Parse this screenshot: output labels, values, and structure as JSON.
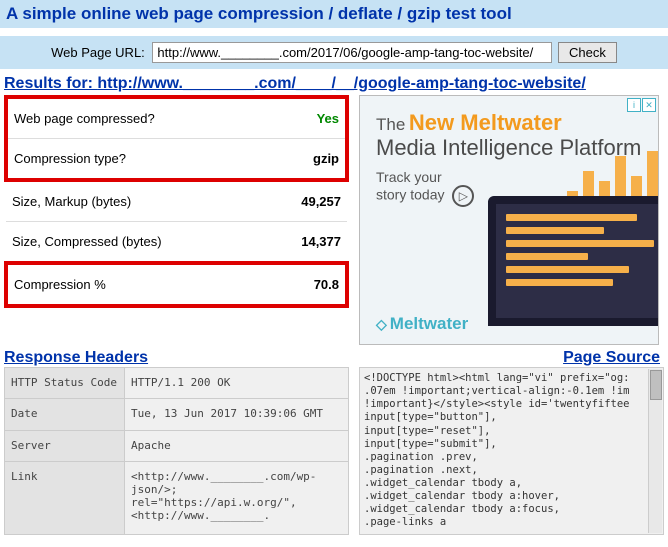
{
  "header": {
    "title": "A simple online web page compression / deflate / gzip test tool"
  },
  "url_form": {
    "label": "Web Page URL:",
    "value": "http://www.________.com/2017/06/google-amp-tang-toc-website/",
    "button": "Check"
  },
  "results": {
    "prefix": "Results for: ",
    "url_display": "http://www.________.com/____/__/google-amp-tang-toc-website/"
  },
  "stats": [
    {
      "label": "Web page compressed?",
      "value": "Yes",
      "highlight": true,
      "greenval": true
    },
    {
      "label": "Compression type?",
      "value": "gzip",
      "highlight": true
    },
    {
      "label": "Size, Markup (bytes)",
      "value": "49,257"
    },
    {
      "label": "Size, Compressed (bytes)",
      "value": "14,377"
    },
    {
      "label": "Compression %",
      "value": "70.8",
      "highlight": true
    }
  ],
  "ad": {
    "the": "The",
    "new_mw": "New Meltwater",
    "mip": "Media Intelligence Platform",
    "cta1": "Track your",
    "cta2": "story today",
    "brand": "Meltwater"
  },
  "sections": {
    "response_headers": "Response Headers",
    "page_source": "Page Source"
  },
  "headers": [
    {
      "key": "HTTP Status Code",
      "val": "HTTP/1.1 200 OK"
    },
    {
      "key": "Date",
      "val": "Tue, 13 Jun 2017 10:39:06 GMT"
    },
    {
      "key": "Server",
      "val": "Apache"
    },
    {
      "key": "Link",
      "val": "<http://www.________.com/wp-json/>; rel=\"https://api.w.org/\", <http://www.________."
    }
  ],
  "source_lines": "<!DOCTYPE html><html lang=\"vi\" prefix=\"og:\n.07em !important;vertical-align:-0.1em !im\n!important}</style><style id='twentyfiftee\ninput[type=\"button\"],\ninput[type=\"reset\"],\ninput[type=\"submit\"],\n.pagination .prev,\n.pagination .next,\n.widget_calendar tbody a,\n.widget_calendar tbody a:hover,\n.widget_calendar tbody a:focus,\n.page-links a"
}
